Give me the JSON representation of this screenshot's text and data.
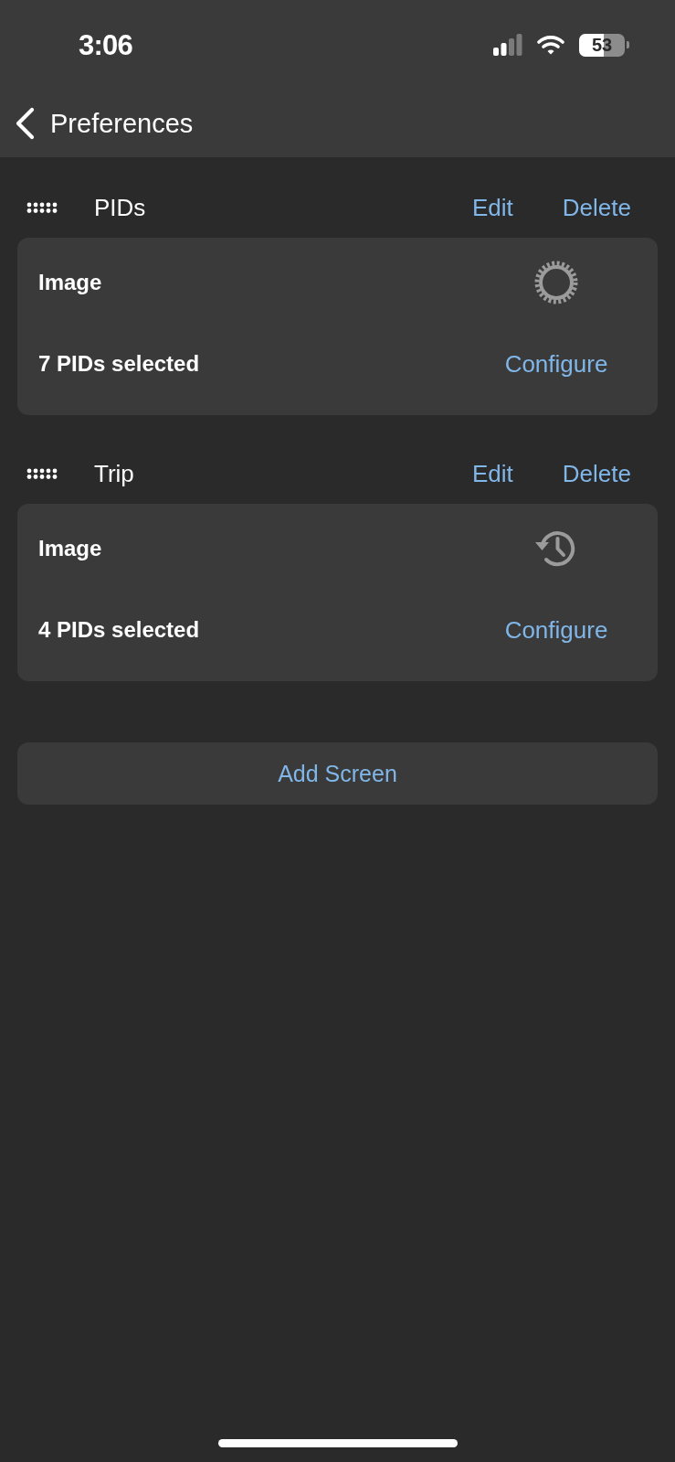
{
  "status_bar": {
    "time": "3:06",
    "battery": "53"
  },
  "nav": {
    "back_label": "Preferences"
  },
  "screens": [
    {
      "title": "PIDs",
      "actions": [
        "Edit",
        "Delete"
      ],
      "card": {
        "label": "Image",
        "kind": "gear",
        "summary": "7 PIDs selected",
        "action": "Configure"
      }
    },
    {
      "title": "Trip",
      "actions": [
        "Edit",
        "Delete"
      ],
      "card": {
        "label": "Image",
        "kind": "history",
        "summary": "4 PIDs selected",
        "action": "Configure"
      }
    }
  ],
  "add_button": "Add Screen"
}
